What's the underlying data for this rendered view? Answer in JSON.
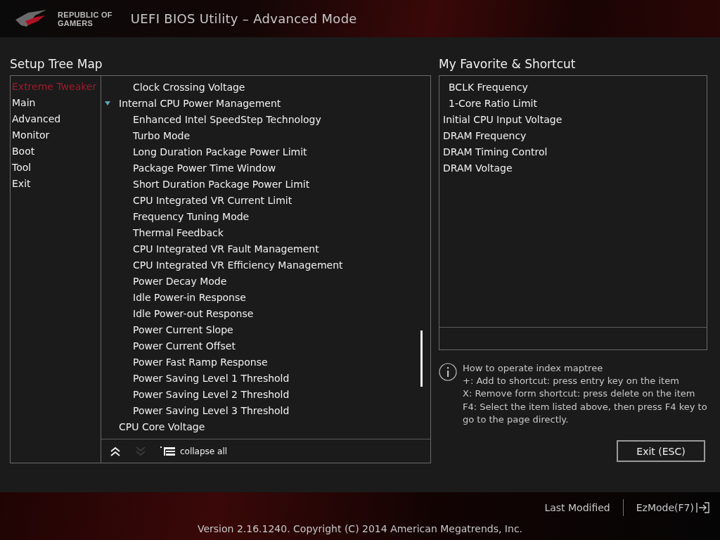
{
  "header": {
    "brand_line_1": "REPUBLIC OF",
    "brand_line_2": "GAMERS",
    "title": "UEFI BIOS Utility – Advanced Mode"
  },
  "setup_tree": {
    "title": "Setup Tree Map",
    "menu": [
      {
        "label": "Extreme Tweaker",
        "selected": true
      },
      {
        "label": "Main",
        "selected": false
      },
      {
        "label": "Advanced",
        "selected": false
      },
      {
        "label": "Monitor",
        "selected": false
      },
      {
        "label": "Boot",
        "selected": false
      },
      {
        "label": "Tool",
        "selected": false
      },
      {
        "label": "Exit",
        "selected": false
      }
    ],
    "tree": [
      {
        "children": [
          {
            "label": "Clock Crossing Voltage"
          }
        ]
      },
      {
        "label": "Internal CPU Power Management",
        "expanded": true,
        "children": [
          {
            "label": "Enhanced Intel SpeedStep Technology"
          },
          {
            "label": "Turbo Mode"
          },
          {
            "label": "Long Duration Package Power Limit"
          },
          {
            "label": "Package Power Time Window"
          },
          {
            "label": "Short Duration Package Power Limit"
          },
          {
            "label": "CPU Integrated VR Current Limit"
          },
          {
            "label": "Frequency Tuning Mode"
          },
          {
            "label": "Thermal Feedback"
          },
          {
            "label": "CPU Integrated VR Fault Management"
          },
          {
            "label": "CPU Integrated VR Efficiency Management"
          },
          {
            "label": "Power Decay Mode"
          },
          {
            "label": "Idle Power-in Response"
          },
          {
            "label": "Idle Power-out Response"
          },
          {
            "label": "Power Current Slope"
          },
          {
            "label": "Power Current Offset"
          },
          {
            "label": "Power Fast Ramp Response"
          },
          {
            "label": "Power Saving Level 1 Threshold"
          },
          {
            "label": "Power Saving Level 2 Threshold"
          },
          {
            "label": "Power Saving Level 3 Threshold"
          }
        ]
      },
      {
        "label": "CPU Core Voltage"
      }
    ],
    "toolbar": [
      {
        "kind": "up",
        "disabled": false
      },
      {
        "kind": "down",
        "disabled": true
      },
      {
        "kind": "collapse",
        "label": "collapse all",
        "disabled": false
      }
    ]
  },
  "favorites": {
    "title": "My Favorite & Shortcut",
    "items": [
      {
        "children": [
          {
            "label": "BCLK Frequency"
          },
          {
            "label": "1-Core Ratio Limit"
          }
        ]
      },
      {
        "label": "Initial CPU Input Voltage"
      },
      {
        "label": "DRAM Frequency"
      },
      {
        "label": "DRAM Timing Control"
      },
      {
        "label": "DRAM Voltage"
      }
    ]
  },
  "help": {
    "lines": [
      "How to operate index maptree",
      "+: Add to shortcut: press entry key on the item",
      "X: Remove form shortcut: press delete on the item",
      "F4: Select the item listed above, then press F4 key to go to the page directly."
    ]
  },
  "exit_button": "Exit (ESC)",
  "footer": {
    "last_modified": "Last Modified",
    "ez_mode": "EzMode(F7)",
    "version": "Version 2.16.1240. Copyright (C) 2014 American Megatrends, Inc."
  }
}
